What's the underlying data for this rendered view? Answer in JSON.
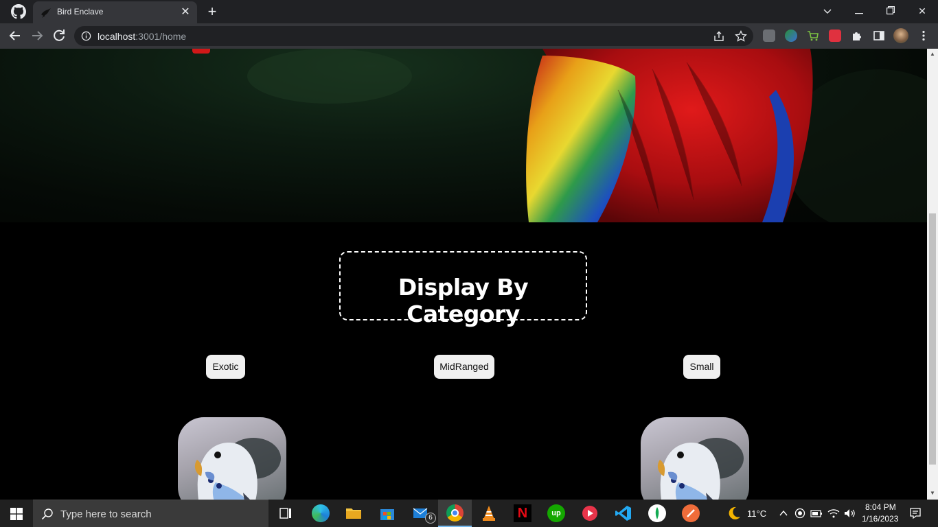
{
  "browser": {
    "tab_title": "Bird Enclave",
    "url_host": "localhost",
    "url_path": ":3001/home"
  },
  "page": {
    "section_title": "Display By Category",
    "categories": [
      {
        "label": "Exotic"
      },
      {
        "label": "MidRanged"
      },
      {
        "label": "Small"
      }
    ]
  },
  "taskbar": {
    "search_placeholder": "Type here to search",
    "mail_badge": "6",
    "temperature": "11°C",
    "time": "8:04 PM",
    "date": "1/16/2023"
  },
  "colors": {
    "accent_red": "#d01818",
    "page_bg": "#000000",
    "button_bg": "#f0f0f0"
  }
}
